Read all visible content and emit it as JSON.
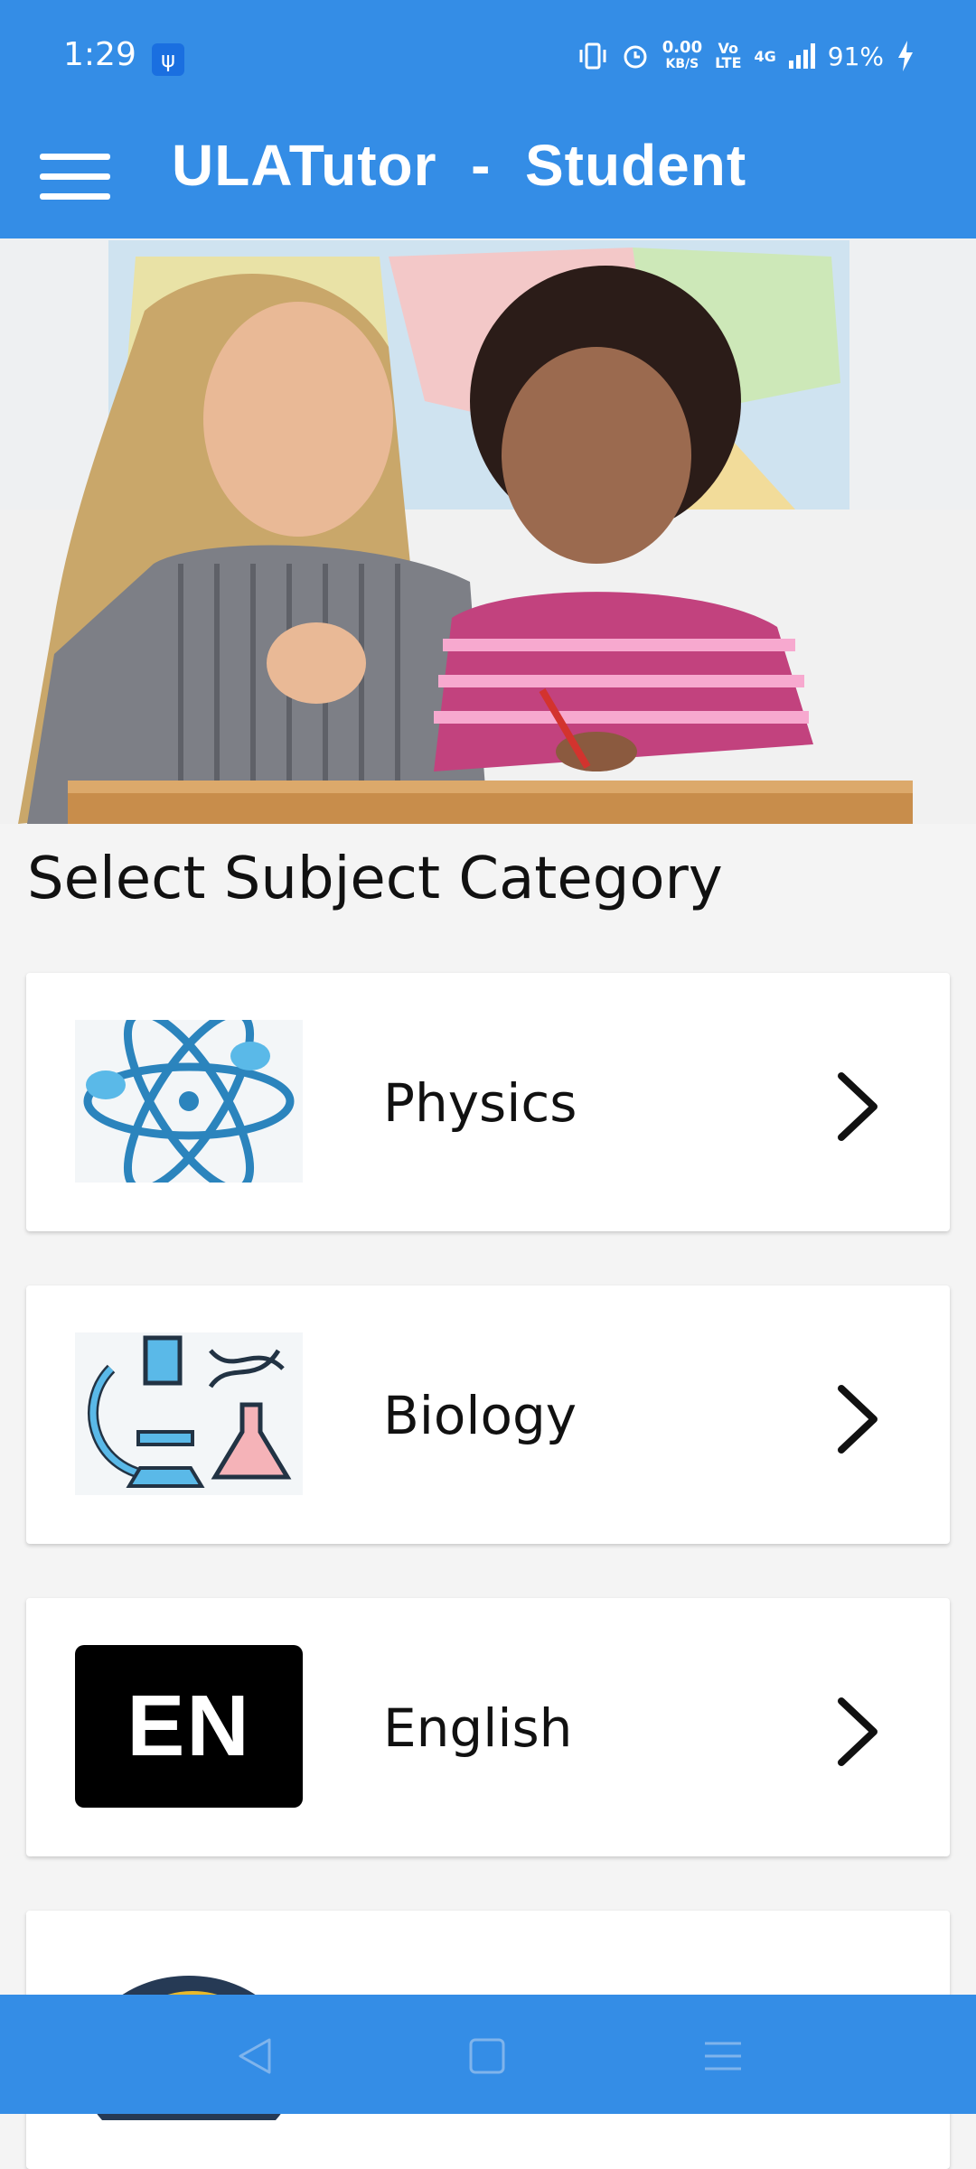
{
  "status_bar": {
    "time": "1:29",
    "net_speed_value": "0.00",
    "net_speed_unit": "KB/S",
    "volte_top": "Vo",
    "volte_bottom": "LTE",
    "network": "4G",
    "battery": "91%"
  },
  "app_bar": {
    "title": "ULATutor  -  Student"
  },
  "main": {
    "section_title": "Select Subject Category",
    "subjects": [
      {
        "label": "Physics",
        "icon": "atom-icon"
      },
      {
        "label": "Biology",
        "icon": "microscope-icon"
      },
      {
        "label": "English",
        "icon": "en-badge-icon",
        "badge_text": "EN"
      },
      {
        "label": "",
        "icon": "globe-icon"
      }
    ]
  },
  "colors": {
    "primary": "#348de6",
    "background": "#f4f4f4",
    "card": "#ffffff"
  }
}
